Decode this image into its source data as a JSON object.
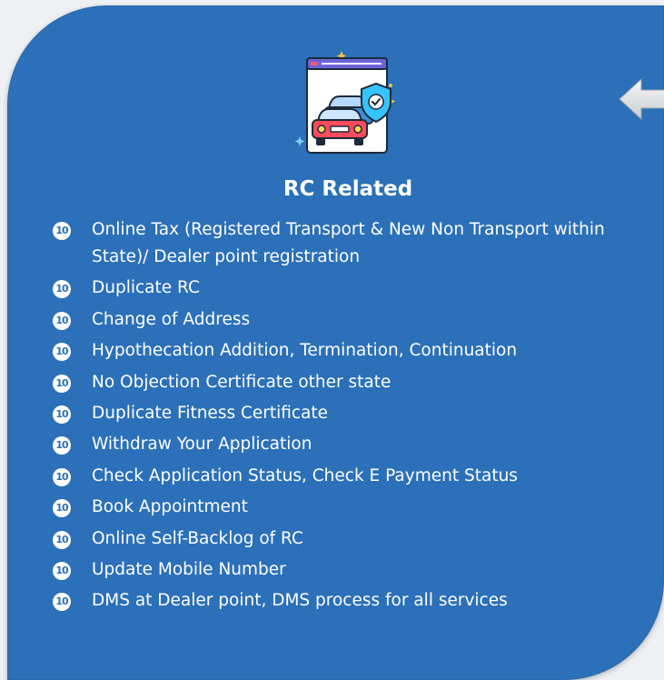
{
  "card": {
    "title": "RC Related",
    "accent_color": "#2b70b8",
    "icon": "vehicle-registration-shield-icon",
    "back_icon": "arrow-left-icon"
  },
  "bullet_glyph": "10",
  "items": [
    {
      "label": "Online Tax (Registered Transport & New Non Transport within State)/ Dealer point registration"
    },
    {
      "label": "Duplicate RC"
    },
    {
      "label": "Change of Address"
    },
    {
      "label": "Hypothecation Addition, Termination, Continuation"
    },
    {
      "label": "No Objection Certificate other state"
    },
    {
      "label": "Duplicate Fitness Certificate"
    },
    {
      "label": "Withdraw Your Application"
    },
    {
      "label": "Check Application Status, Check E Payment Status"
    },
    {
      "label": "Book Appointment"
    },
    {
      "label": "Online Self-Backlog of RC"
    },
    {
      "label": "Update Mobile Number"
    },
    {
      "label": "DMS at Dealer point, DMS process for all services"
    }
  ]
}
